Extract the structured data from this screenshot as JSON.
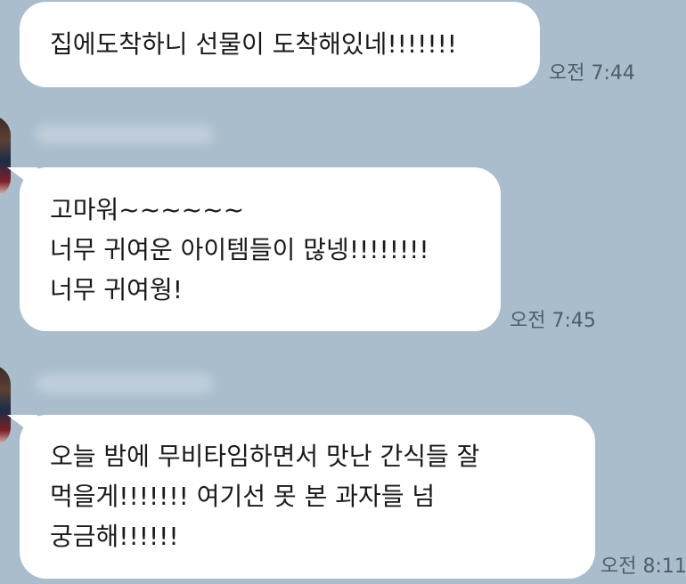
{
  "messages": [
    {
      "lines": [
        "집에도착하니 선물이 도착해있네!!!!!!!"
      ],
      "time": "오전 7:44"
    },
    {
      "lines": [
        "고마워~~~~~~",
        "너무 귀여운 아이템들이 많넹!!!!!!!!",
        "너무 귀여웡!"
      ],
      "time": "오전 7:45"
    },
    {
      "lines": [
        "오늘 밤에 무비타임하면서 맛난 간식들 잘",
        "먹을게!!!!!!! 여기선 못 본 과자들 넘",
        "궁금해!!!!!!"
      ],
      "time": "오전 8:11"
    }
  ],
  "colors": {
    "background": "#a9bdcd",
    "bubble": "#ffffff",
    "text": "#1a1a1a",
    "time_text": "#4f5d69"
  }
}
